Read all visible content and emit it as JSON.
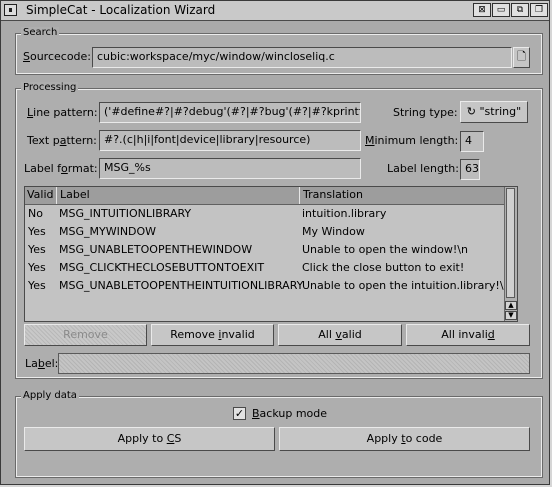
{
  "window": {
    "title": "SimpleCat - Localization Wizard"
  },
  "search": {
    "group_label": "Search",
    "sourcecode_label": "Sourcecode:",
    "sourcecode_value": "cubic:workspace/myc/window/wincloseliq.c"
  },
  "processing": {
    "group_label": "Processing",
    "line_pattern_label": "Line pattern:",
    "line_pattern_value": "('#define#?|#?debug'(#?|#?bug'(#?|#?kprintf'(#?)",
    "text_pattern_label": "Text pattern:",
    "text_pattern_value": "#?.(c|h|i|font|device|library|resource)",
    "label_format_label": "Label format:",
    "label_format_value": "MSG_%s",
    "string_type_label": "String type:",
    "string_type_value": "\"string\"",
    "min_length_label": "Minimum length:",
    "min_length_value": "4",
    "label_length_label": "Label length:",
    "label_length_value": "63",
    "table": {
      "headers": {
        "valid": "Valid",
        "label": "Label",
        "translation": "Translation"
      },
      "rows": [
        {
          "valid": "No",
          "label": "MSG_INTUITIONLIBRARY",
          "translation": "intuition.library"
        },
        {
          "valid": "Yes",
          "label": "MSG_MYWINDOW",
          "translation": "My Window"
        },
        {
          "valid": "Yes",
          "label": "MSG_UNABLETOOPENTHEWINDOW",
          "translation": "Unable to open the window!\\n"
        },
        {
          "valid": "Yes",
          "label": "MSG_CLICKTHECLOSEBUTTONTOEXIT",
          "translation": "Click the close button to exit!"
        },
        {
          "valid": "Yes",
          "label": "MSG_UNABLETOOPENTHEINTUITIONLIBRARY",
          "translation": "Unable to open the intuition.library!\\n"
        }
      ]
    },
    "buttons": {
      "remove": "Remove",
      "remove_invalid": "Remove invalid",
      "all_valid": "All valid",
      "all_invalid": "All invalid"
    },
    "label_field_label": "Label:",
    "label_field_value": ""
  },
  "apply": {
    "group_label": "Apply data",
    "backup_label": "Backup mode",
    "backup_checked": true,
    "apply_cs": "Apply to CS",
    "apply_code": "Apply to code"
  }
}
